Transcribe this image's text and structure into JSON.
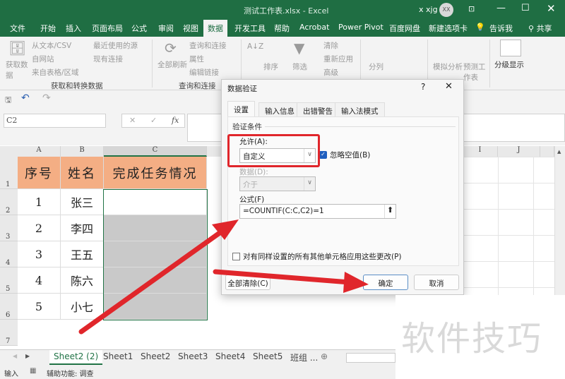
{
  "window": {
    "title": "测试工作表.xlsx - Excel",
    "user": "x xjg",
    "avatar": "XX",
    "controls": [
      "ribbon-display",
      "minimize",
      "maximize",
      "close"
    ]
  },
  "ribbon_tabs": [
    "文件",
    "开始",
    "插入",
    "页面布局",
    "公式",
    "审阅",
    "视图",
    "数据",
    "开发工具",
    "帮助",
    "Acrobat",
    "Power Pivot",
    "百度网盘",
    "新建选项卡",
    "告诉我",
    "共享"
  ],
  "selected_tab": "数据",
  "ribbon": {
    "get_data": {
      "button": "获取数据",
      "items": [
        "从文本/CSV",
        "自网站",
        "来自表格/区域",
        "最近使用的源",
        "现有连接"
      ],
      "label": "获取和转换数据"
    },
    "queries": {
      "button": "全部刷新",
      "items": [
        "查询和连接",
        "属性",
        "编辑链接"
      ],
      "label": "查询和连接"
    },
    "sort": {
      "button": "排序"
    },
    "filter": {
      "button": "筛选",
      "items": [
        "清除",
        "重新应用",
        "高级"
      ]
    },
    "tools": {
      "button": "分列"
    },
    "forecast": {
      "items": [
        "模拟分析",
        "预测工作表"
      ]
    },
    "outline": {
      "button": "分级显示"
    }
  },
  "name_box": "C2",
  "formula_icons": [
    "cancel-icon",
    "enter-icon",
    "fx-icon"
  ],
  "columns": [
    "A",
    "B",
    "C",
    "I",
    "J"
  ],
  "rows": [
    "1",
    "2",
    "3",
    "4",
    "5",
    "6",
    "7"
  ],
  "table": {
    "headers": [
      "序号",
      "姓名",
      "完成任务情况"
    ],
    "rows": [
      [
        "1",
        "张三",
        ""
      ],
      [
        "2",
        "李四",
        ""
      ],
      [
        "3",
        "王五",
        ""
      ],
      [
        "4",
        "陈六",
        ""
      ],
      [
        "5",
        "小七",
        ""
      ]
    ]
  },
  "sheets": [
    "Sheet2 (2)",
    "Sheet1",
    "Sheet2",
    "Sheet3",
    "Sheet4",
    "Sheet5",
    "班组 ..."
  ],
  "active_sheet": "Sheet2 (2)",
  "status": {
    "mode": "输入",
    "accessibility": "辅助功能: 调查"
  },
  "dialog": {
    "title": "数据验证",
    "help": "?",
    "tabs": [
      "设置",
      "输入信息",
      "出错警告",
      "输入法模式"
    ],
    "active_tab": "设置",
    "section": "验证条件",
    "allow_label": "允许(A):",
    "allow_value": "自定义",
    "ignore_blank": {
      "label": "忽略空值(B)",
      "checked": true
    },
    "data_label": "数据(D):",
    "data_value": "介于",
    "formula_label": "公式(F)",
    "formula_value": "=COUNTIF(C:C,C2)=1",
    "apply_all": {
      "label": "对有同样设置的所有其他单元格应用这些更改(P)",
      "checked": false
    },
    "clear_all": "全部清除(C)",
    "ok": "确定",
    "cancel": "取消"
  },
  "watermark": "软件技巧",
  "colors": {
    "excel_green": "#1f6e43",
    "header_fill": "#f4ae84",
    "annotation_red": "#e0262b",
    "selection_gray": "#c9c9c9"
  }
}
